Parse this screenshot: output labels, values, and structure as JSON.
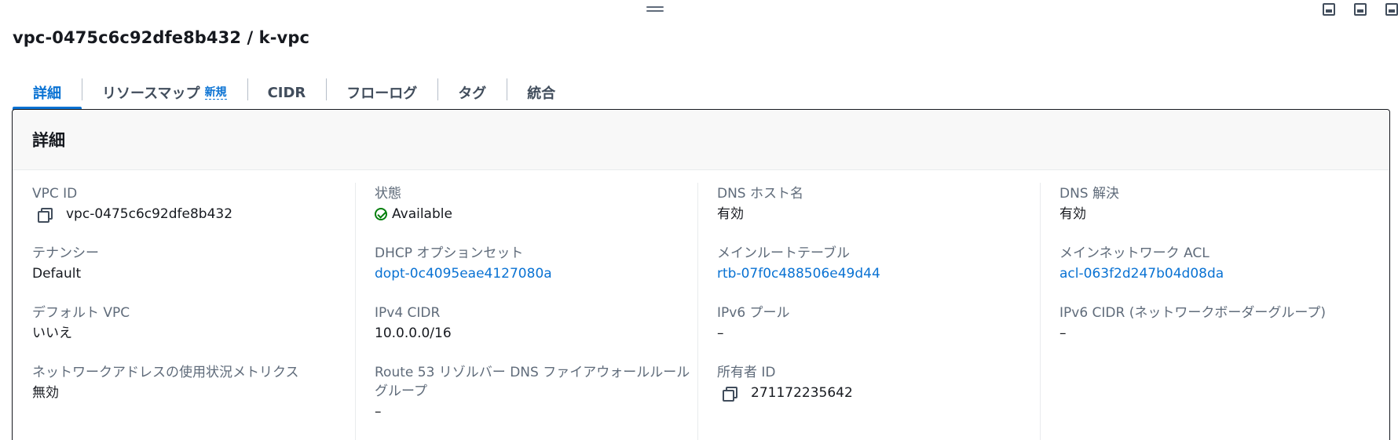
{
  "page": {
    "title": "vpc-0475c6c92dfe8b432 / k-vpc"
  },
  "tabs": [
    {
      "label": "詳細",
      "active": true
    },
    {
      "label": "リソースマップ",
      "badge": "新規"
    },
    {
      "label": "CIDR"
    },
    {
      "label": "フローログ"
    },
    {
      "label": "タグ"
    },
    {
      "label": "統合"
    }
  ],
  "panel": {
    "heading": "詳細",
    "columns": [
      [
        {
          "label": "VPC ID",
          "value": "vpc-0475c6c92dfe8b432"
        },
        {
          "label": "テナンシー",
          "value": "Default"
        },
        {
          "label": "デフォルト VPC",
          "value": "いいえ"
        },
        {
          "label": "ネットワークアドレスの使用状況メトリクス",
          "value": "無効"
        }
      ],
      [
        {
          "label": "状態",
          "value": "Available"
        },
        {
          "label": "DHCP オプションセット",
          "value": "dopt-0c4095eae4127080a"
        },
        {
          "label": "IPv4 CIDR",
          "value": "10.0.0.0/16"
        },
        {
          "label": "Route 53 リゾルバー DNS ファイアウォールルールグループ",
          "value": "–"
        }
      ],
      [
        {
          "label": "DNS ホスト名",
          "value": "有効"
        },
        {
          "label": "メインルートテーブル",
          "value": "rtb-07f0c488506e49d44"
        },
        {
          "label": "IPv6 プール",
          "value": "–"
        },
        {
          "label": "所有者 ID",
          "value": "271172235642"
        }
      ],
      [
        {
          "label": "DNS 解決",
          "value": "有効"
        },
        {
          "label": "メインネットワーク ACL",
          "value": "acl-063f2d247b04d08da"
        },
        {
          "label": "IPv6 CIDR (ネットワークボーダーグループ)",
          "value": "–"
        }
      ]
    ]
  },
  "colors": {
    "link": "#0972d3",
    "success": "#037f0c",
    "text": "#16191f",
    "label": "#5f6b7a"
  }
}
